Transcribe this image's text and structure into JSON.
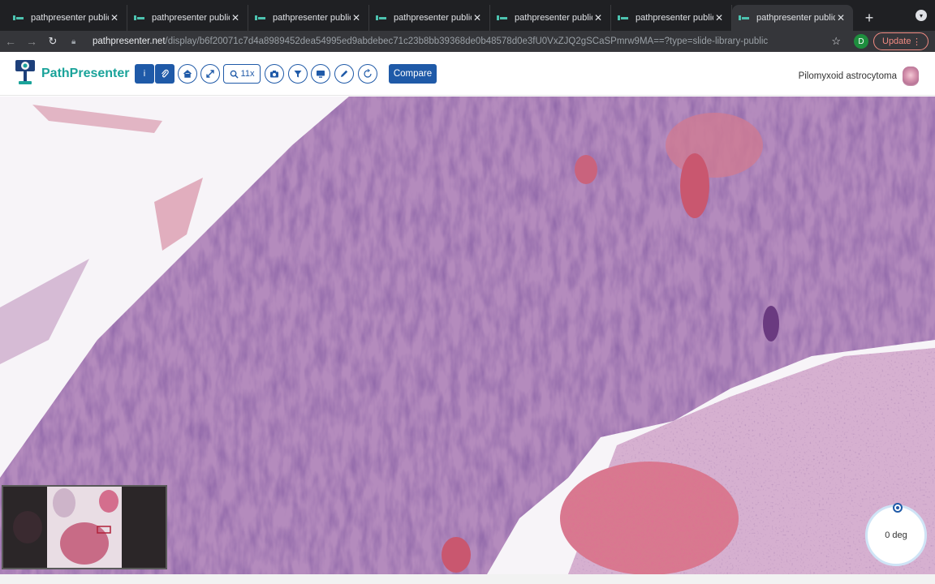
{
  "browser": {
    "tabs": [
      {
        "title": "pathpresenter public",
        "active": false
      },
      {
        "title": "pathpresenter public",
        "active": false
      },
      {
        "title": "pathpresenter public",
        "active": false
      },
      {
        "title": "pathpresenter public",
        "active": false
      },
      {
        "title": "pathpresenter public",
        "active": false
      },
      {
        "title": "pathpresenter public",
        "active": false
      },
      {
        "title": "pathpresenter public",
        "active": true
      }
    ],
    "url_domain": "pathpresenter.net",
    "url_path": "/display/b6f20071c7d4a8989452dea54995ed9abdebec71c23b8bb39368de0b48578d0e3fU0VxZJQ2gSCaSPmrw9MA==?type=slide-library-public",
    "profile_initial": "D",
    "update_label": "Update"
  },
  "app": {
    "brand": "PathPresenter",
    "zoom_label": "11x",
    "compare_label": "Compare",
    "case_title": "Pilomyxoid astrocytoma",
    "rotation_label": "0 deg",
    "brand_color": "#1aa39a",
    "accent_color": "#1f5aa8"
  },
  "icons": {
    "info": "info-icon",
    "annotations": "paperclip-icon",
    "home": "home-icon",
    "fullscreen": "expand-icon",
    "zoom": "magnifier-icon",
    "snapshot": "camera-icon",
    "filter": "filter-icon",
    "present": "monitor-icon",
    "draw": "pencil-icon",
    "rotate": "rotate-icon"
  }
}
